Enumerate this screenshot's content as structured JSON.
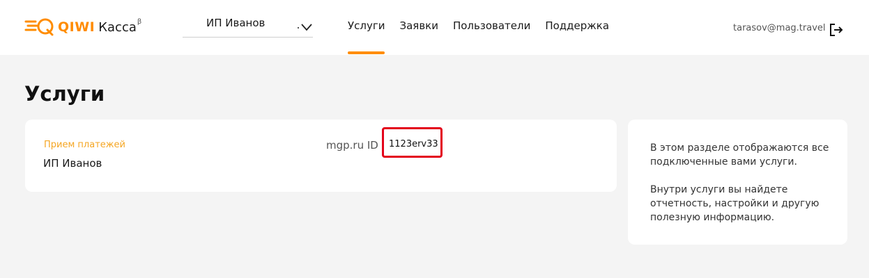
{
  "header": {
    "logo": {
      "brand": "QIWI",
      "product": "Касса",
      "badge": "β"
    },
    "org_select": {
      "value": "ИП Иванов"
    },
    "nav": [
      {
        "label": "Услуги",
        "active": true
      },
      {
        "label": "Заявки",
        "active": false
      },
      {
        "label": "Пользователи",
        "active": false
      },
      {
        "label": "Поддержка",
        "active": false
      }
    ],
    "user_email": "tarasov@mag.travel"
  },
  "page": {
    "title": "Услуги"
  },
  "service": {
    "type": "Прием платежей",
    "name": "ИП Иванов",
    "id_label": "mgp.ru ID",
    "id_value": "1123erv33"
  },
  "info": {
    "paragraph_1": "В этом разделе отображаются все подключенные вами услуги.",
    "paragraph_2": "Внутри услуги вы найдете отчетность, настройки и другую полезную информацию."
  },
  "colors": {
    "accent": "#ff8c00",
    "service_type": "#f5a623",
    "highlight": "#e3001b",
    "background": "#f4f4f4"
  },
  "icons": {
    "logo": "qiwi-logo-icon",
    "chevron": "chevron-down-icon",
    "logout": "logout-icon"
  }
}
